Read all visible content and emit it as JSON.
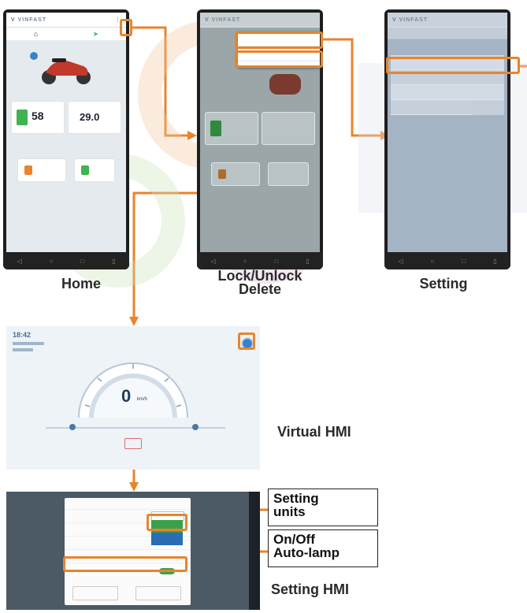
{
  "brand": "VINFAST",
  "captions": {
    "home": "Home",
    "lock_unlock": "Lock/Unlock",
    "delete": "Delete",
    "setting": "Setting",
    "virtual_hmi": "Virtual HMI",
    "setting_hmi": "Setting HMI"
  },
  "callouts": {
    "setting_units_line1": "Setting",
    "setting_units_line2": "units",
    "auto_lamp_line1": "On/Off",
    "auto_lamp_line2": "Auto-lamp"
  },
  "home": {
    "battery_value": "58",
    "odometer_value": "29.0"
  },
  "virtual_hmi": {
    "time": "18:42",
    "speed_value": "0",
    "speed_unit": "km/h"
  },
  "colors": {
    "accent": "#e8842c",
    "phone_frame": "#1e1e1e",
    "battery_green": "#3fb34f",
    "dialog_blue": "#2a6db5",
    "dialog_green": "#3aa14a"
  }
}
